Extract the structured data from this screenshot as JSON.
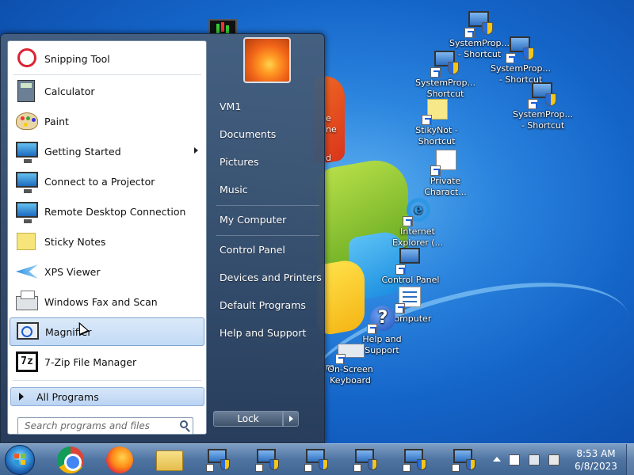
{
  "start_menu": {
    "programs": [
      {
        "label": "Snipping Tool",
        "icon": "snipping-tool-icon"
      },
      {
        "label": "Calculator",
        "icon": "calculator-icon"
      },
      {
        "label": "Paint",
        "icon": "paint-icon"
      },
      {
        "label": "Getting Started",
        "icon": "getting-started-icon",
        "submenu": true
      },
      {
        "label": "Connect to a Projector",
        "icon": "projector-icon"
      },
      {
        "label": "Remote Desktop Connection",
        "icon": "remote-desktop-icon"
      },
      {
        "label": "Sticky Notes",
        "icon": "sticky-notes-icon"
      },
      {
        "label": "XPS Viewer",
        "icon": "xps-viewer-icon"
      },
      {
        "label": "Windows Fax and Scan",
        "icon": "fax-scan-icon"
      },
      {
        "label": "Magnifier",
        "icon": "magnifier-icon",
        "selected": true
      },
      {
        "label": "7-Zip File Manager",
        "icon": "seven-zip-icon"
      }
    ],
    "all_programs": "All Programs",
    "search_placeholder": "Search programs and files",
    "right_links": [
      "VM1",
      "Documents",
      "Pictures",
      "Music",
      "My Computer",
      "Control Panel",
      "Devices and Printers",
      "Default Programs",
      "Help and Support"
    ],
    "lock_label": "Lock"
  },
  "desktop": {
    "icons": [
      {
        "label1": "SystemProp...",
        "label2": "- Shortcut"
      },
      {
        "label1": "SystemProp...",
        "label2": "Shortcut"
      },
      {
        "label1": "SystemProp...",
        "label2": "- Shortcut"
      },
      {
        "label1": "SystemProp...",
        "label2": "- Shortcut"
      },
      {
        "label1": "StikyNot -",
        "label2": "Shortcut"
      },
      {
        "label1": "Private",
        "label2": "Charact..."
      },
      {
        "label1": "Internet",
        "label2": "Explorer (..."
      },
      {
        "label1": "Control Panel",
        "label2": ""
      },
      {
        "label1": "Computer",
        "label2": ""
      },
      {
        "label1": "Help and",
        "label2": "Support"
      },
      {
        "label1": "On-Screen",
        "label2": "Keyboard"
      }
    ],
    "partial_labels": [
      "e",
      "ne",
      "d",
      "ro"
    ]
  },
  "taskbar": {
    "clock_time": "8:53 AM",
    "clock_date": "6/8/2023",
    "apps": [
      "chrome-icon",
      "firefox-icon",
      "explorer-icon",
      "system-properties-icon",
      "system-properties-icon",
      "system-properties-icon",
      "system-properties-icon",
      "system-properties-icon",
      "system-properties-icon"
    ]
  },
  "colors": {
    "desktop_blue": "#1464c8",
    "start_menu_glass": "#465f7d",
    "selected_item": "#c2daf6"
  }
}
